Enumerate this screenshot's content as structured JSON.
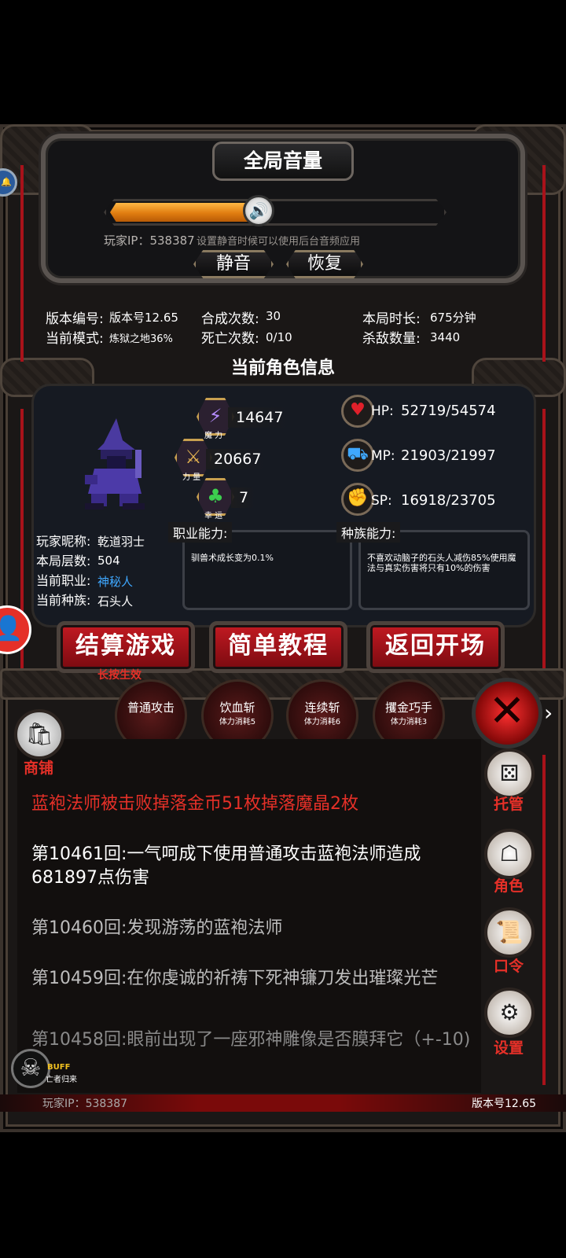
{
  "volume": {
    "title": "全局音量",
    "level_fraction": 0.45,
    "player_ip_label": "玩家IP：538387",
    "hint": "设置静音时候可以使用后台音频应用",
    "mute_label": "静音",
    "restore_label": "恢复"
  },
  "stats": {
    "version_label": "版本编号:",
    "version_value": "版本号12.65",
    "mode_label": "当前模式:",
    "mode_value": "炼狱之地36%",
    "craft_label": "合成次数:",
    "craft_value": "30",
    "death_label": "死亡次数:",
    "death_value": "0/10",
    "duration_label": "本局时长:",
    "duration_value": "675分钟",
    "kills_label": "杀敌数量:",
    "kills_value": "3440"
  },
  "character": {
    "title": "当前角色信息",
    "magic_value": "14647",
    "magic_caption": "魔 力",
    "strength_value": "20667",
    "strength_caption": "力 量",
    "luck_value": "7",
    "luck_caption": "幸 运",
    "hp_label": "HP:",
    "hp_value": "52719/54574",
    "mp_label": "MP:",
    "mp_value": "21903/21997",
    "sp_label": "SP:",
    "sp_value": "16918/23705",
    "nickname_label": "玩家昵称:",
    "nickname_value": "乾道羽士",
    "floor_label": "本局层数:",
    "floor_value": "504",
    "class_label": "当前职业:",
    "class_value": "神秘人",
    "race_label": "当前种族:",
    "race_value": "石头人",
    "job_ability_label": "职业能力:",
    "job_ability_text": "驯兽术成长变为0.1%",
    "race_ability_label": "种族能力:",
    "race_ability_text": "不喜欢动脑子的石头人减伤85%使用魔法与真实伤害将只有10%的伤害"
  },
  "buttons": {
    "settle": "结算游戏",
    "settle_sub": "长按生效",
    "tutorial": "简单教程",
    "return": "返回开场"
  },
  "skills": [
    {
      "name": "普通攻击",
      "cost": ""
    },
    {
      "name": "饮血斩",
      "cost": "体力消耗5"
    },
    {
      "name": "连续斩",
      "cost": "体力消耗6"
    },
    {
      "name": "攫金巧手",
      "cost": "体力消耗3"
    }
  ],
  "side": {
    "shop": "商铺",
    "auto": "托管",
    "role": "角色",
    "code": "口令",
    "settings": "设置"
  },
  "log": [
    "蓝袍法师被击败掉落金币51枚掉落魔晶2枚",
    "第10461回:一气呵成下使用普通攻击蓝袍法师造成681897点伤害",
    "第10460回:发现游荡的蓝袍法师",
    "第10459回:在你虔诚的祈祷下死神镰刀发出璀璨光芒",
    "第10458回:眼前出现了一座邪神雕像是否膜拜它（+-10)"
  ],
  "buff": {
    "title": "BUFF",
    "name": "亡者归来"
  },
  "footer": {
    "ip": "玩家IP：538387",
    "version": "版本号12.65"
  },
  "colors": {
    "accent_red": "#e53028",
    "class_blue": "#3fa8ff",
    "volume_orange": "#f09a20"
  }
}
